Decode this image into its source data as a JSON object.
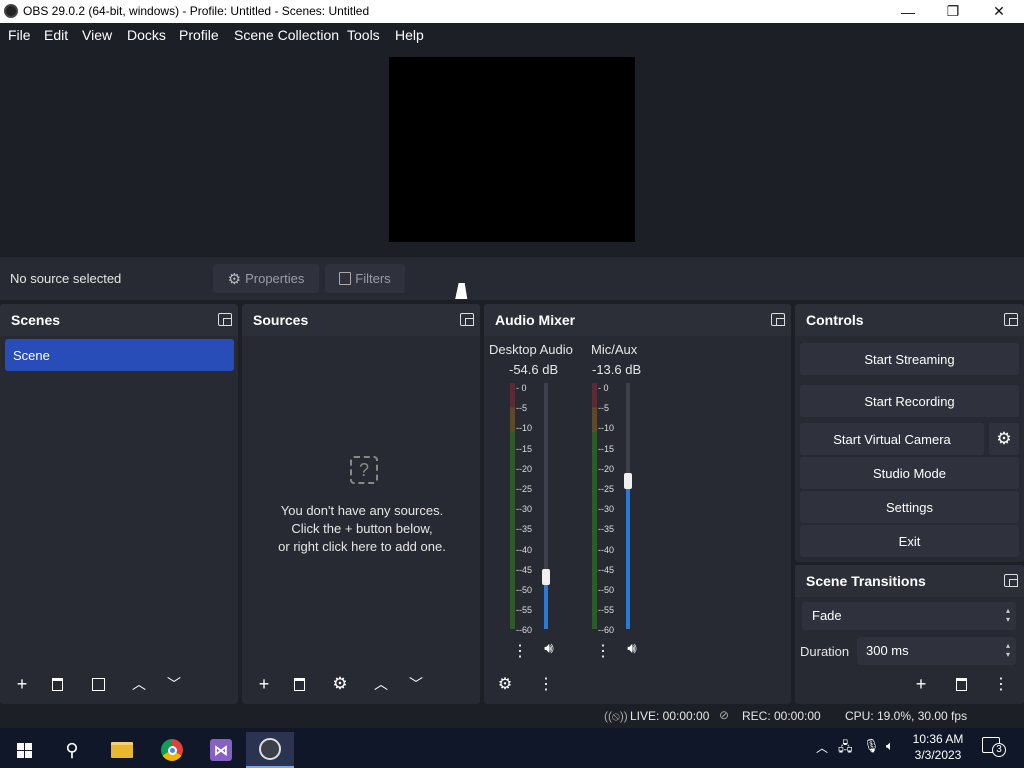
{
  "window": {
    "title": "OBS 29.0.2 (64-bit, windows) - Profile: Untitled - Scenes: Untitled",
    "minimize_glyph": "—",
    "maximize_glyph": "❐",
    "close_glyph": "✕"
  },
  "menu": [
    "File",
    "Edit",
    "View",
    "Docks",
    "Profile",
    "Scene Collection",
    "Tools",
    "Help"
  ],
  "context": {
    "no_source": "No source selected",
    "properties": "Properties",
    "filters": "Filters"
  },
  "docks": {
    "scenes": {
      "title": "Scenes",
      "items": [
        "Scene"
      ]
    },
    "sources": {
      "title": "Sources",
      "empty_line1": "You don't have any sources.",
      "empty_line2": "Click the + button below,",
      "empty_line3": "or right click here to add one.",
      "empty_icon": "?"
    },
    "audio": {
      "title": "Audio Mixer",
      "channels": [
        {
          "name": "Desktop Audio",
          "db": "-54.6 dB",
          "level": 0.21
        },
        {
          "name": "Mic/Aux",
          "db": "-13.6 dB",
          "level": 0.6
        }
      ],
      "ticks": [
        "0",
        "-5",
        "-10",
        "-15",
        "-20",
        "-25",
        "-30",
        "-35",
        "-40",
        "-45",
        "-50",
        "-55",
        "-60"
      ]
    },
    "controls": {
      "title": "Controls",
      "start_streaming": "Start Streaming",
      "start_recording": "Start Recording",
      "start_virtual_camera": "Start Virtual Camera",
      "studio_mode": "Studio Mode",
      "settings": "Settings",
      "exit": "Exit"
    },
    "transitions": {
      "title": "Scene Transitions",
      "selected": "Fade",
      "duration_label": "Duration",
      "duration_value": "300 ms"
    }
  },
  "status": {
    "live": "LIVE: 00:00:00",
    "rec": "REC: 00:00:00",
    "cpu": "CPU: 19.0%, 30.00 fps"
  },
  "taskbar": {
    "time": "10:36 AM",
    "date": "3/3/2023",
    "notifications": "3"
  },
  "colors": {
    "accent": "#284cb8",
    "background": "#1d1f26",
    "panel": "#272a33",
    "volume": "#2a7ad7"
  }
}
